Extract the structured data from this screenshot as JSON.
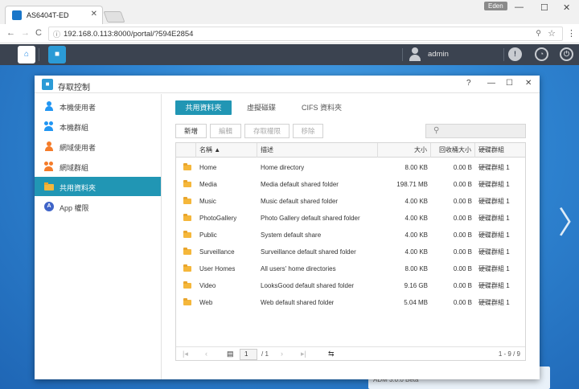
{
  "browser": {
    "tab_title": "AS6404T-ED",
    "tab_close": "✕",
    "user_tag": "Eden",
    "url": "192.168.0.113:8000/portal/?594E2854",
    "win_min": "—",
    "win_max": "☐",
    "win_close": "✕",
    "back": "←",
    "forward": "→",
    "reload": "C"
  },
  "taskbar": {
    "username": "admin"
  },
  "widget": {
    "text": "ADM 3.0.0 Beta"
  },
  "window": {
    "title": "存取控制",
    "help": "?",
    "minimize": "—",
    "maximize": "☐",
    "close": "✕"
  },
  "sidebar": {
    "items": [
      {
        "label": "本機使用者"
      },
      {
        "label": "本機群組"
      },
      {
        "label": "網域使用者"
      },
      {
        "label": "網域群組"
      },
      {
        "label": "共用資料夾"
      },
      {
        "label": "App 權限"
      }
    ]
  },
  "tabs": [
    {
      "label": "共用資料夾"
    },
    {
      "label": "虛擬磁碟"
    },
    {
      "label": "CIFS 資料夾"
    }
  ],
  "toolbar": {
    "add": "新增",
    "edit": "編輯",
    "access": "存取權限",
    "remove": "移除"
  },
  "table": {
    "headers": {
      "name": "名稱 ▲",
      "desc": "描述",
      "size": "大小",
      "recycle": "回收桶大小",
      "volume": "硬碟群組"
    },
    "rows": [
      {
        "name": "Home",
        "desc": "Home directory",
        "size": "8.00 KB",
        "recycle": "0.00 B",
        "volume": "硬碟群組 1"
      },
      {
        "name": "Media",
        "desc": "Media default shared folder",
        "size": "198.71 MB",
        "recycle": "0.00 B",
        "volume": "硬碟群組 1"
      },
      {
        "name": "Music",
        "desc": "Music default shared folder",
        "size": "4.00 KB",
        "recycle": "0.00 B",
        "volume": "硬碟群組 1"
      },
      {
        "name": "PhotoGallery",
        "desc": "Photo Gallery default shared folder",
        "size": "4.00 KB",
        "recycle": "0.00 B",
        "volume": "硬碟群組 1"
      },
      {
        "name": "Public",
        "desc": "System default share",
        "size": "4.00 KB",
        "recycle": "0.00 B",
        "volume": "硬碟群組 1"
      },
      {
        "name": "Surveillance",
        "desc": "Surveillance default shared folder",
        "size": "4.00 KB",
        "recycle": "0.00 B",
        "volume": "硬碟群組 1"
      },
      {
        "name": "User Homes",
        "desc": "All users' home directories",
        "size": "8.00 KB",
        "recycle": "0.00 B",
        "volume": "硬碟群組 1"
      },
      {
        "name": "Video",
        "desc": "LooksGood default shared folder",
        "size": "9.16 GB",
        "recycle": "0.00 B",
        "volume": "硬碟群組 1"
      },
      {
        "name": "Web",
        "desc": "Web default shared folder",
        "size": "5.04 MB",
        "recycle": "0.00 B",
        "volume": "硬碟群組 1"
      }
    ]
  },
  "pager": {
    "page": "1",
    "total": "/ 1",
    "count": "1 - 9 / 9"
  },
  "colors": {
    "accent": "#2196b4",
    "taskbar": "#3b4350",
    "folder": "#f5b73b"
  }
}
